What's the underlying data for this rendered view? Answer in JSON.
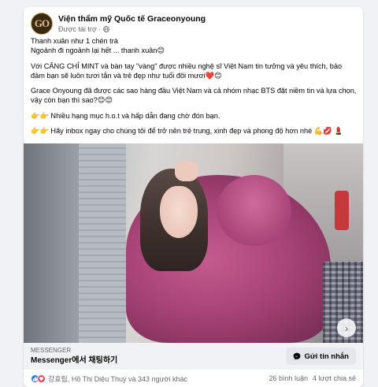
{
  "post": {
    "page_name": "Viện thẩm mỹ Quốc tế Graceonyoung",
    "logo_text": "GO",
    "sponsored_label": "Được tài trợ",
    "separator": "·",
    "paragraphs": [
      {
        "lines": [
          "Thanh xuân như 1 chén trà",
          "Ngoảnh đi ngoảnh lại hết ... thanh xuân😊"
        ]
      },
      {
        "lines": [
          "Với CĂNG CHỈ MINT và bàn tay \"vàng\" được nhiều nghệ sĩ Việt Nam tin tưởng và yêu thích, bảo đảm bạn sẽ luôn tươi tắn và trẻ đẹp như tuổi đôi mươi❤️😊"
        ]
      },
      {
        "lines": [
          "Grace Onyoung đã được các sao hàng đầu Việt Nam và cả nhóm nhạc BTS đặt niềm tin và lựa chọn, vậy còn bạn thì sao?😊😊"
        ]
      },
      {
        "lines": [
          "👉👉 Nhiều hạng mục h.o.t và hấp dẫn đang chờ đón bạn."
        ]
      },
      {
        "lines": [
          "👉👉 Hãy inbox ngay cho chúng tôi để trở nên trẻ trung, xinh đẹp và phong độ hơn nhé 💪💋 💄"
        ]
      }
    ]
  },
  "media": {
    "next_icon": "chevron-right-icon",
    "next_glyph": "›"
  },
  "cta": {
    "caption": "MESSENGER",
    "headline": "Messenger에서 채팅하기",
    "button_label": "Gửi tin nhắn",
    "button_icon": "messenger-icon"
  },
  "footer": {
    "reaction_icons": [
      "like-icon",
      "love-icon"
    ],
    "reactors": "강효림, Hồ Thị Diệu Thuý và 343 người khác",
    "comments": "26 bình luận",
    "shares": "4 lượt chia sẻ"
  },
  "colors": {
    "background": "#f0f2f5",
    "card": "#ffffff",
    "like": "#1877f2",
    "love": "#f33e58",
    "muted_text": "#65676b"
  }
}
